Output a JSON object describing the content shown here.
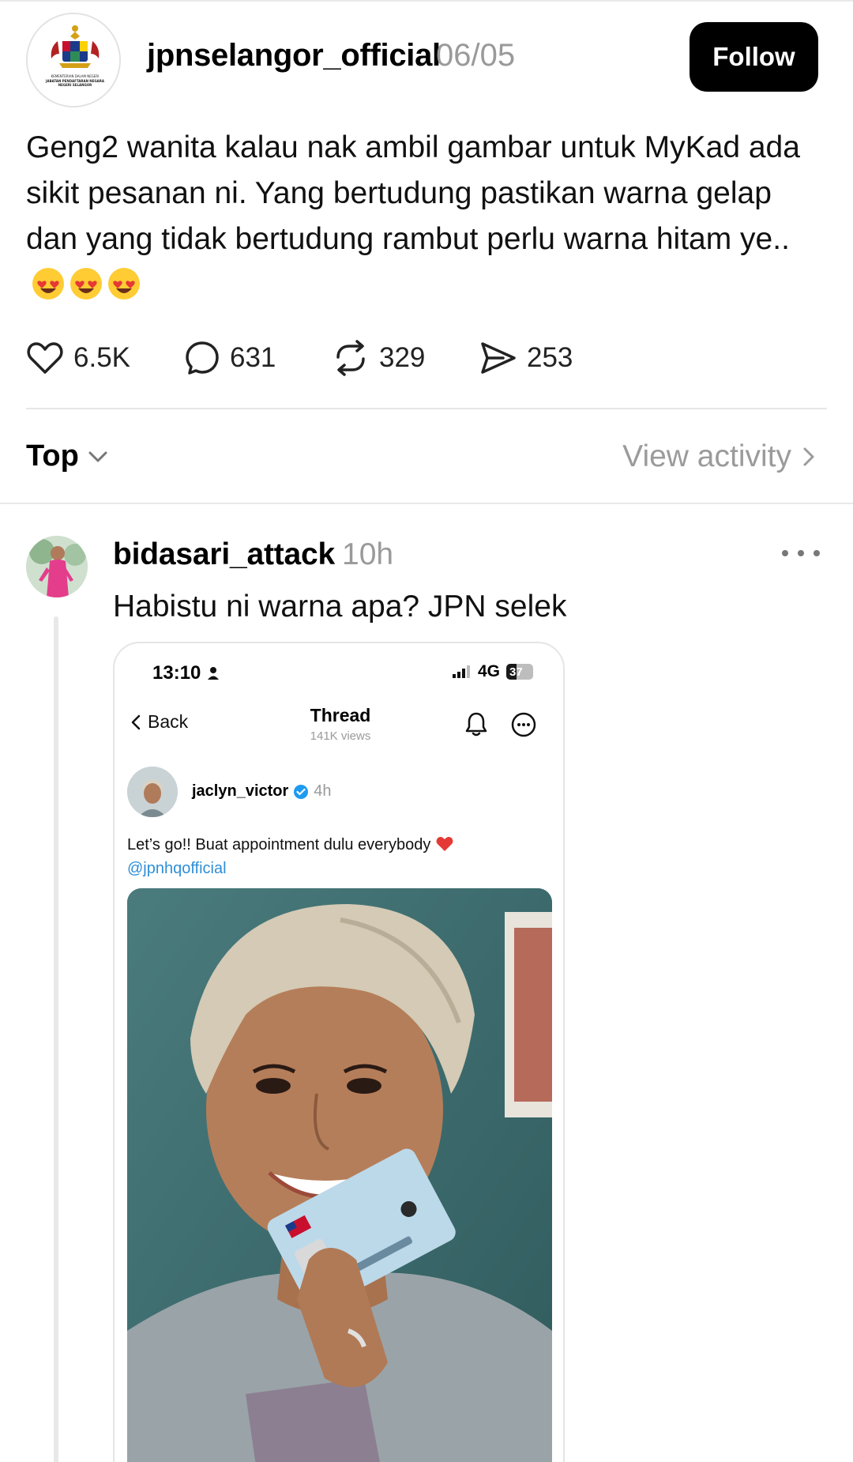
{
  "post": {
    "username": "jpnselangor_official",
    "date": "06/05",
    "follow_label": "Follow",
    "logo_text": [
      "KEMENTERIAN DALAM NEGERI",
      "JABATAN PENDAFTARAN NEGARA",
      "NEGERI SELANGOR"
    ],
    "text": "Geng2 wanita kalau nak ambil gambar untuk MyKad ada sikit pesanan ni. Yang bertudung pastikan warna gelap dan yang tidak bertudung rambut perlu warna hitam ye..",
    "emojis": [
      "heart-eyes-emoji",
      "heart-eyes-emoji",
      "heart-eyes-emoji"
    ],
    "likes": "6.5K",
    "comments": "631",
    "reposts": "329",
    "shares": "253"
  },
  "sort": {
    "label": "Top",
    "view_activity": "View activity"
  },
  "reply": {
    "username": "bidasari_attack",
    "time": "10h",
    "text": "Habistu ni warna apa? JPN selek"
  },
  "screenshot": {
    "status_time": "13:10",
    "network": "4G",
    "battery": "37",
    "battery_level": 0.37,
    "back_label": "Back",
    "title": "Thread",
    "views": "141K views",
    "username": "jaclyn_victor",
    "time": "4h",
    "text": "Let’s go!! Buat appointment dulu everybody",
    "mention": "@jpnhqofficial"
  },
  "colors": {
    "accent": "#000000",
    "muted": "#9a9a9a",
    "verified": "#1d9bf0",
    "mention": "#2f8ed6"
  }
}
